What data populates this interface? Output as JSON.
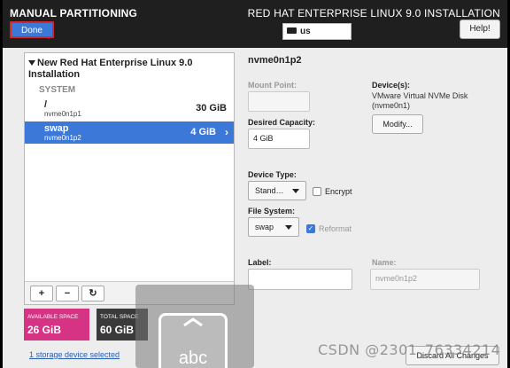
{
  "header": {
    "title": "MANUAL PARTITIONING",
    "product": "RED HAT ENTERPRISE LINUX 9.0 INSTALLATION",
    "done_label": "Done",
    "keyboard_layout": "us",
    "help_label": "Help!"
  },
  "partitions": {
    "installation_title": "New Red Hat Enterprise Linux 9.0 Installation",
    "group_label": "SYSTEM",
    "items": [
      {
        "mount": "/",
        "device": "nvme0n1p1",
        "size": "30 GiB",
        "selected": false
      },
      {
        "mount": "swap",
        "device": "nvme0n1p2",
        "size": "4 GiB",
        "selected": true
      }
    ],
    "toolbar": {
      "add": "+",
      "remove": "−",
      "refresh": "↻"
    }
  },
  "space": {
    "available_label": "AVAILABLE SPACE",
    "available_value": "26 GiB",
    "total_label": "TOTAL SPACE",
    "total_value": "60 GiB",
    "colors": {
      "available": "#d63384",
      "total": "#3a3a3a"
    }
  },
  "storage_link": "1 storage device selected",
  "detail": {
    "title": "nvme0n1p2",
    "mount_point_label": "Mount Point:",
    "mount_point_value": "",
    "desired_capacity_label": "Desired Capacity:",
    "desired_capacity_value": "4 GiB",
    "devices_label": "Device(s):",
    "devices_value": "VMware Virtual NVMe Disk (nvme0n1)",
    "modify_label": "Modify...",
    "device_type_label": "Device Type:",
    "device_type_value": "Stand…",
    "encrypt_label": "Encrypt",
    "encrypt_checked": false,
    "file_system_label": "File System:",
    "file_system_value": "swap",
    "reformat_label": "Reformat",
    "reformat_checked": true,
    "label_label": "Label:",
    "label_value": "",
    "name_label": "Name:",
    "name_value": "nvme0n1p2"
  },
  "discard_label": "Discard All Changes",
  "overlay": {
    "keyboard_text": "abc",
    "watermark": "CSDN @2301_76334214"
  },
  "accent_color": "#3c78d8"
}
